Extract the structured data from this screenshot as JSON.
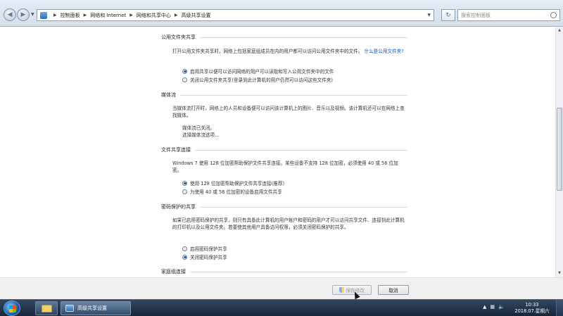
{
  "address": {
    "crumbs": [
      "控制面板",
      "网络和 Internet",
      "网络和共享中心",
      "高级共享设置"
    ],
    "search_placeholder": "搜索控制面板"
  },
  "sections": {
    "public": {
      "title": "公用文件夹共享",
      "desc": "打开公用文件夹共享时，网络上包括家庭组成员在内的用户都可以访问公用文件夹中的文件。",
      "link": "什么是公用文件夹?",
      "opt1": "启用共享以便可以访问网络的用户可以读取和写入公用文件夹中的文件",
      "opt2": "关闭公用文件夹共享(登录到此计算机的用户仍然可以访问这些文件夹)"
    },
    "media": {
      "title": "媒体流",
      "desc": "当媒体流打开时，网络上的人员和设备便可以访问该计算机上的图片、音乐以及视频。该计算机还可以在网络上查找媒体。",
      "status": "媒体流已关闭。",
      "link": "选择媒体流选项..."
    },
    "fileshare": {
      "title": "文件共享连接",
      "desc": "Windows 7 使用 128 位加密帮助保护文件共享连接。某些设备不支持 128 位加密，必须使用 40 或 56 位加密。",
      "opt1": "使用 128 位加密帮助保护文件共享连接(推荐)",
      "opt2": "为使用 40 或 56 位加密的设备启用文件共享"
    },
    "password": {
      "title": "密码保护的共享",
      "desc": "如果已启用密码保护的共享，则只有具备此计算机的用户帐户和密码的用户才可以访问共享文件、连接到此计算机的打印机以及公用文件夹。若要使其他用户具备访问权限，必须关闭密码保护的共享。",
      "opt1": "启用密码保护共享",
      "opt2": "关闭密码保护共享"
    },
    "homegroup": {
      "title": "家庭组连接"
    }
  },
  "actions": {
    "save": "保存修改",
    "cancel": "取消"
  },
  "taskbar": {
    "app_label": "高级共享设置",
    "time": "10:33",
    "date": "2018.07.星期六"
  }
}
